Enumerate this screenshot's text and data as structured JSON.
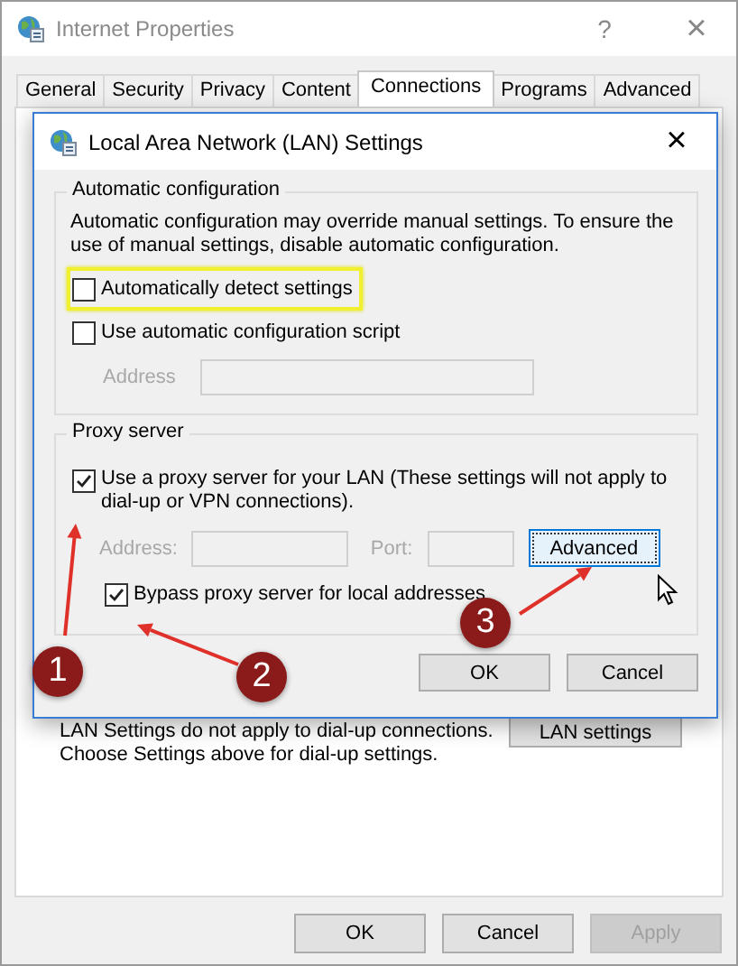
{
  "window": {
    "title": "Internet Properties",
    "help": "?",
    "close": "×"
  },
  "tabs": [
    {
      "label": "General",
      "selected": false
    },
    {
      "label": "Security",
      "selected": false
    },
    {
      "label": "Privacy",
      "selected": false
    },
    {
      "label": "Content",
      "selected": false
    },
    {
      "label": "Connections",
      "selected": true
    },
    {
      "label": "Programs",
      "selected": false
    },
    {
      "label": "Advanced",
      "selected": false
    }
  ],
  "panel": {
    "note": "LAN Settings do not apply to dial-up connections.\nChoose Settings above for dial-up settings.",
    "lan_button": "LAN settings"
  },
  "buttons": [
    {
      "label": "OK",
      "disabled": false
    },
    {
      "label": "Cancel",
      "disabled": false
    },
    {
      "label": "Apply",
      "disabled": true
    }
  ],
  "dialog": {
    "title": "Local Area Network (LAN) Settings",
    "close": "×",
    "auto_group": {
      "legend": "Automatic configuration",
      "description": "Automatic configuration may override manual settings.  To ensure the\nuse of manual settings, disable automatic configuration.",
      "options": [
        {
          "label": "Automatically detect settings",
          "checked": false,
          "highlighted": true
        },
        {
          "label": "Use automatic configuration script",
          "checked": false,
          "highlighted": false
        }
      ],
      "address": {
        "label": "Address",
        "disabled": true
      }
    },
    "proxy_group": {
      "legend": "Proxy server",
      "use_proxy": {
        "label": "Use a proxy server for your LAN (These settings will not apply to\ndial-up or VPN connections).",
        "checked": true
      },
      "address": {
        "label": "Address:",
        "disabled": true
      },
      "port": {
        "label": "Port:",
        "disabled": true
      },
      "advanced": {
        "label": "Advanced",
        "focused": true
      },
      "bypass": {
        "label": "Bypass proxy server for local addresses",
        "checked": true
      }
    },
    "buttons": [
      {
        "label": "OK"
      },
      {
        "label": "Cancel"
      }
    ]
  },
  "annotations": [
    {
      "number": "1"
    },
    {
      "number": "2"
    },
    {
      "number": "3"
    }
  ]
}
